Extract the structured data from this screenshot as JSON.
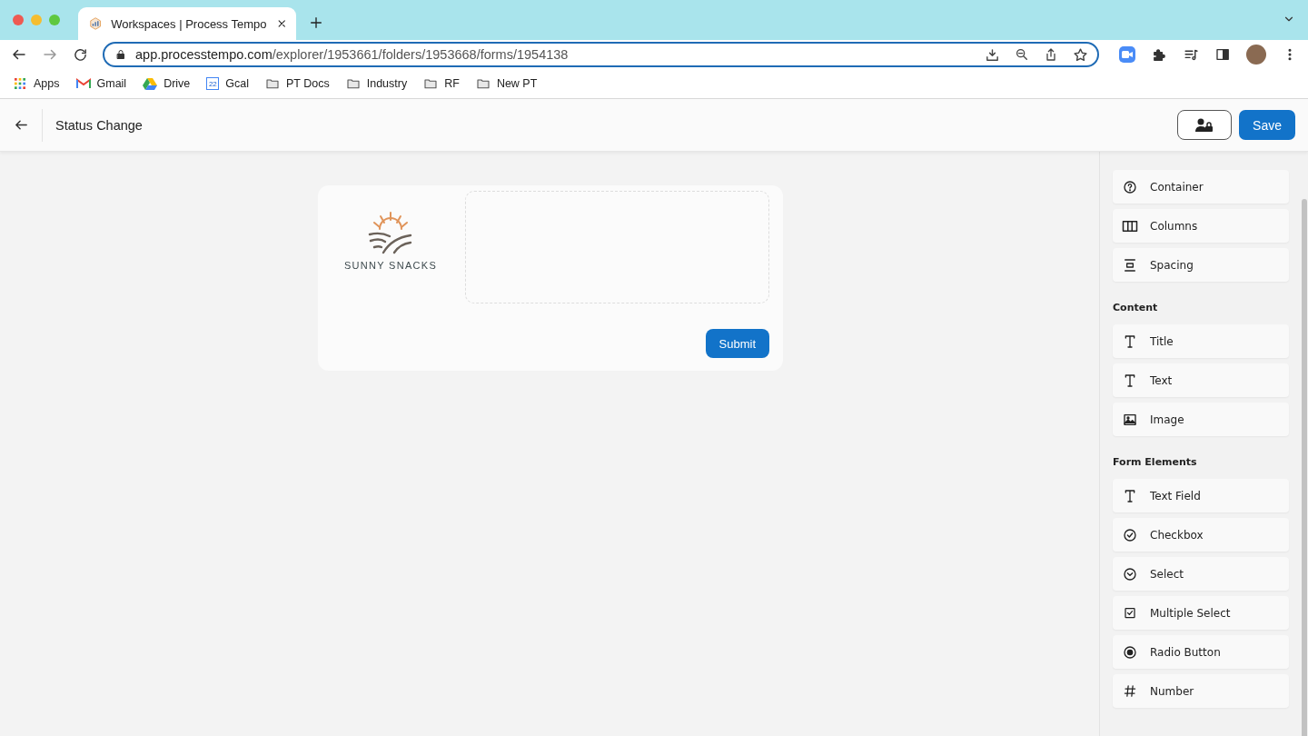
{
  "browser": {
    "tab": {
      "title": "Workspaces | Process Tempo"
    },
    "address": {
      "domain": "app.processtempo.com",
      "path": "/explorer/1953661/folders/1953668/forms/1954138"
    },
    "bookmarks": [
      {
        "label": "Apps",
        "kind": "apps"
      },
      {
        "label": "Gmail",
        "kind": "mail"
      },
      {
        "label": "Drive",
        "kind": "drive"
      },
      {
        "label": "Gcal",
        "kind": "calendar",
        "badge": "22"
      },
      {
        "label": "PT Docs",
        "kind": "folder"
      },
      {
        "label": "Industry",
        "kind": "folder"
      },
      {
        "label": "RF",
        "kind": "folder"
      },
      {
        "label": "New PT",
        "kind": "folder"
      }
    ]
  },
  "header": {
    "title": "Status Change",
    "save": "Save"
  },
  "form": {
    "logo_text": "SUNNY SNACKS",
    "submit": "Submit"
  },
  "palette": [
    {
      "items": [
        {
          "label": "Container",
          "kind": "container"
        },
        {
          "label": "Columns",
          "kind": "columns"
        },
        {
          "label": "Spacing",
          "kind": "spacing"
        }
      ]
    },
    {
      "heading": "Content",
      "items": [
        {
          "label": "Title",
          "kind": "type"
        },
        {
          "label": "Text",
          "kind": "type"
        },
        {
          "label": "Image",
          "kind": "image"
        }
      ]
    },
    {
      "heading": "Form Elements",
      "items": [
        {
          "label": "Text Field",
          "kind": "type"
        },
        {
          "label": "Checkbox",
          "kind": "check"
        },
        {
          "label": "Select",
          "kind": "select"
        },
        {
          "label": "Multiple Select",
          "kind": "multi"
        },
        {
          "label": "Radio Button",
          "kind": "radio"
        },
        {
          "label": "Number",
          "kind": "number"
        }
      ]
    }
  ]
}
